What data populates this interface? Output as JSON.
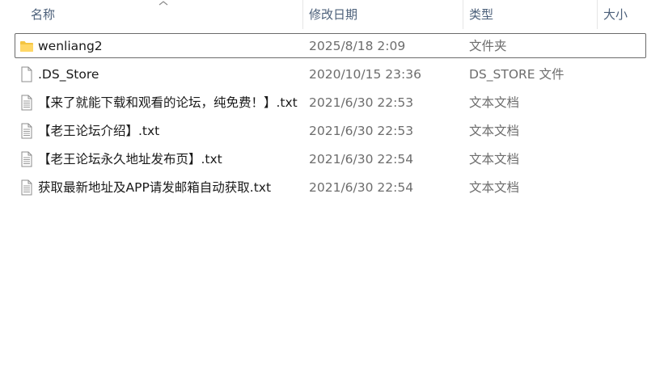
{
  "columns": {
    "name": "名称",
    "date": "修改日期",
    "type": "类型",
    "size": "大小"
  },
  "rows": [
    {
      "icon": "folder-icon",
      "name": "wenliang2",
      "date": "2025/8/18 2:09",
      "type": "文件夹",
      "size": ""
    },
    {
      "icon": "file-icon",
      "name": ".DS_Store",
      "date": "2020/10/15 23:36",
      "type": "DS_STORE 文件",
      "size": ""
    },
    {
      "icon": "text-file-icon",
      "name": "【来了就能下载和观看的论坛，纯免费！】.txt",
      "date": "2021/6/30 22:53",
      "type": "文本文档",
      "size": ""
    },
    {
      "icon": "text-file-icon",
      "name": "【老王论坛介绍】.txt",
      "date": "2021/6/30 22:53",
      "type": "文本文档",
      "size": ""
    },
    {
      "icon": "text-file-icon",
      "name": "【老王论坛永久地址发布页】.txt",
      "date": "2021/6/30 22:54",
      "type": "文本文档",
      "size": ""
    },
    {
      "icon": "text-file-icon",
      "name": "获取最新地址及APP请发邮箱自动获取.txt",
      "date": "2021/6/30 22:54",
      "type": "文本文档",
      "size": ""
    }
  ],
  "colors": {
    "header_text": "#4c607a",
    "folder": "#f4c542",
    "selection_border": "#6b6b6b"
  }
}
